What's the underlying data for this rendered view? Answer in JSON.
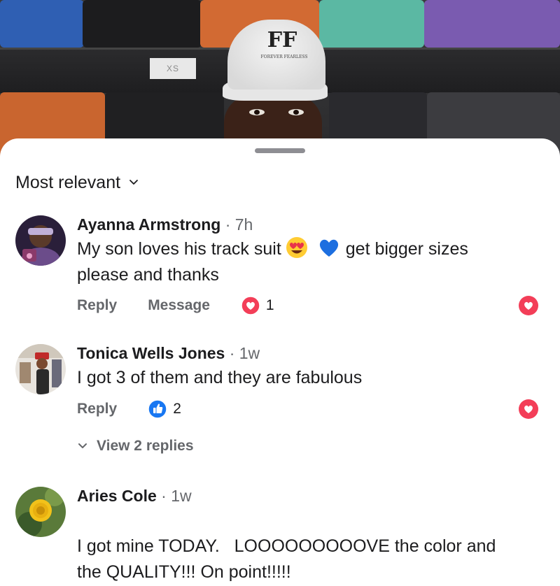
{
  "video": {
    "size_tag": "XS",
    "hat_logo": "FF",
    "hat_text": "FOREVER FEARLESS"
  },
  "sheet": {
    "sort": {
      "label": "Most relevant",
      "icon": "chevron-down-icon"
    }
  },
  "comments": [
    {
      "author": "Ayanna Armstrong",
      "time": "· 7h",
      "text_before": "My son loves his track suit",
      "text_after": "get bigger sizes",
      "text_line2": "please and thanks",
      "emojis": [
        "heart-eyes-emoji",
        "blue-heart-emoji"
      ],
      "reply_label": "Reply",
      "message_label": "Message",
      "reaction": {
        "icon": "love-reaction-icon",
        "count": "1"
      }
    },
    {
      "author": "Tonica Wells Jones",
      "time": "· 1w",
      "text": "I got 3 of them and they are fabulous",
      "reply_label": "Reply",
      "reaction": {
        "icon": "like-reaction-icon",
        "count": "2"
      },
      "view_replies": "View 2 replies"
    },
    {
      "author": "Aries Cole",
      "time": "· 1w",
      "text_line1": "I got mine TODAY.   LOOOOOOOOOVE the color and",
      "text_line2": "the QUALITY!!! On point!!!!!"
    }
  ],
  "colors": {
    "love_red": "#f33e58",
    "like_blue": "#1877f2",
    "secondary_text": "#65676b"
  }
}
